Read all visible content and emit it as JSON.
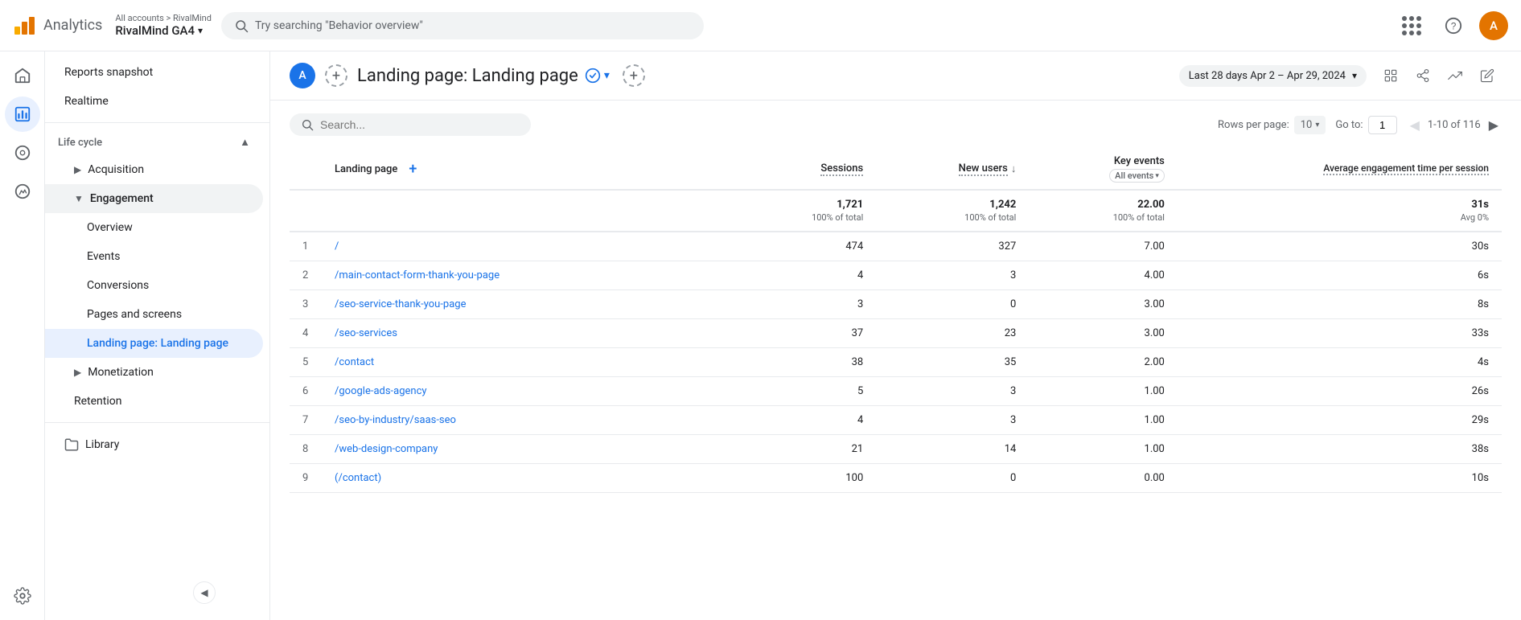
{
  "app": {
    "title": "Analytics",
    "account_path": "All accounts > RivalMind",
    "account_name": "RivalMind GA4",
    "avatar_letter": "A"
  },
  "search": {
    "placeholder": "Try searching \"Behavior overview\""
  },
  "sidebar": {
    "nav_items": [
      {
        "id": "reports-snapshot",
        "label": "Reports snapshot",
        "level": 0
      },
      {
        "id": "realtime",
        "label": "Realtime",
        "level": 0
      },
      {
        "id": "lifecycle",
        "label": "Life cycle",
        "level": 0,
        "section": true
      },
      {
        "id": "acquisition",
        "label": "Acquisition",
        "level": 1,
        "expandable": true
      },
      {
        "id": "engagement",
        "label": "Engagement",
        "level": 1,
        "expandable": true,
        "expanded": true
      },
      {
        "id": "overview",
        "label": "Overview",
        "level": 2
      },
      {
        "id": "events",
        "label": "Events",
        "level": 2
      },
      {
        "id": "conversions",
        "label": "Conversions",
        "level": 2
      },
      {
        "id": "pages-screens",
        "label": "Pages and screens",
        "level": 2
      },
      {
        "id": "landing-page",
        "label": "Landing page: Landing page",
        "level": 2,
        "active": true
      },
      {
        "id": "monetization",
        "label": "Monetization",
        "level": 1,
        "expandable": true
      },
      {
        "id": "retention",
        "label": "Retention",
        "level": 1
      },
      {
        "id": "library",
        "label": "Library",
        "level": 0,
        "icon": "folder"
      }
    ]
  },
  "content": {
    "page_title": "Landing page: Landing page",
    "date_range": "Last 28 days  Apr 2 – Apr 29, 2024",
    "segment_avatar": "A"
  },
  "table": {
    "search_placeholder": "Search...",
    "rows_per_page_label": "Rows per page:",
    "rows_per_page_value": "10",
    "go_to_label": "Go to:",
    "go_to_value": "1",
    "pagination": "1-10 of 116",
    "columns": [
      {
        "id": "landing-page",
        "label": "Landing page",
        "align": "left"
      },
      {
        "id": "sessions",
        "label": "Sessions",
        "align": "right",
        "dotted": true
      },
      {
        "id": "new-users",
        "label": "New users",
        "align": "right",
        "dotted": true
      },
      {
        "id": "key-events",
        "label": "Key events",
        "align": "right",
        "sub": "All events"
      },
      {
        "id": "avg-engagement",
        "label": "Average engagement time per session",
        "align": "right",
        "dotted": true
      }
    ],
    "totals": {
      "sessions": "1,721",
      "sessions_pct": "100% of total",
      "new_users": "1,242",
      "new_users_pct": "100% of total",
      "key_events": "22.00",
      "key_events_pct": "100% of total",
      "avg_engagement": "31s",
      "avg_engagement_pct": "Avg 0%"
    },
    "rows": [
      {
        "num": 1,
        "page": "/",
        "sessions": "474",
        "new_users": "327",
        "key_events": "7.00",
        "avg_engagement": "30s"
      },
      {
        "num": 2,
        "page": "/main-contact-form-thank-you-page",
        "sessions": "4",
        "new_users": "3",
        "key_events": "4.00",
        "avg_engagement": "6s"
      },
      {
        "num": 3,
        "page": "/seo-service-thank-you-page",
        "sessions": "3",
        "new_users": "0",
        "key_events": "3.00",
        "avg_engagement": "8s"
      },
      {
        "num": 4,
        "page": "/seo-services",
        "sessions": "37",
        "new_users": "23",
        "key_events": "3.00",
        "avg_engagement": "33s"
      },
      {
        "num": 5,
        "page": "/contact",
        "sessions": "38",
        "new_users": "35",
        "key_events": "2.00",
        "avg_engagement": "4s"
      },
      {
        "num": 6,
        "page": "/google-ads-agency",
        "sessions": "5",
        "new_users": "3",
        "key_events": "1.00",
        "avg_engagement": "26s"
      },
      {
        "num": 7,
        "page": "/seo-by-industry/saas-seo",
        "sessions": "4",
        "new_users": "3",
        "key_events": "1.00",
        "avg_engagement": "29s"
      },
      {
        "num": 8,
        "page": "/web-design-company",
        "sessions": "21",
        "new_users": "14",
        "key_events": "1.00",
        "avg_engagement": "38s"
      },
      {
        "num": 9,
        "page": "(/contact)",
        "sessions": "100",
        "new_users": "0",
        "key_events": "0.00",
        "avg_engagement": "10s"
      }
    ]
  }
}
